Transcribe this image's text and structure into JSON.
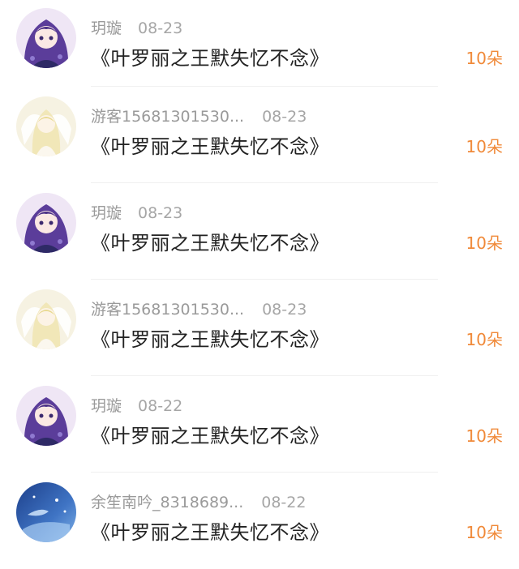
{
  "colors": {
    "accent": "#f08a3a",
    "name": "#9a9a9a",
    "title": "#222222"
  },
  "rows": [
    {
      "avatar": "avatar-purple-girl",
      "name": "玥璇",
      "date": "08-23",
      "title": "《叶罗丽之王默失忆不念》",
      "amount": "10朵"
    },
    {
      "avatar": "avatar-white-angel",
      "name": "游客15681301530...",
      "date": "08-23",
      "title": "《叶罗丽之王默失忆不念》",
      "amount": "10朵"
    },
    {
      "avatar": "avatar-purple-girl",
      "name": "玥璇",
      "date": "08-23",
      "title": "《叶罗丽之王默失忆不念》",
      "amount": "10朵"
    },
    {
      "avatar": "avatar-white-angel",
      "name": "游客15681301530...",
      "date": "08-23",
      "title": "《叶罗丽之王默失忆不念》",
      "amount": "10朵"
    },
    {
      "avatar": "avatar-purple-girl",
      "name": "玥璇",
      "date": "08-22",
      "title": "《叶罗丽之王默失忆不念》",
      "amount": "10朵"
    },
    {
      "avatar": "avatar-blue-night",
      "name": "余笙南吟_8318689...",
      "date": "08-22",
      "title": "《叶罗丽之王默失忆不念》",
      "amount": "10朵"
    }
  ]
}
